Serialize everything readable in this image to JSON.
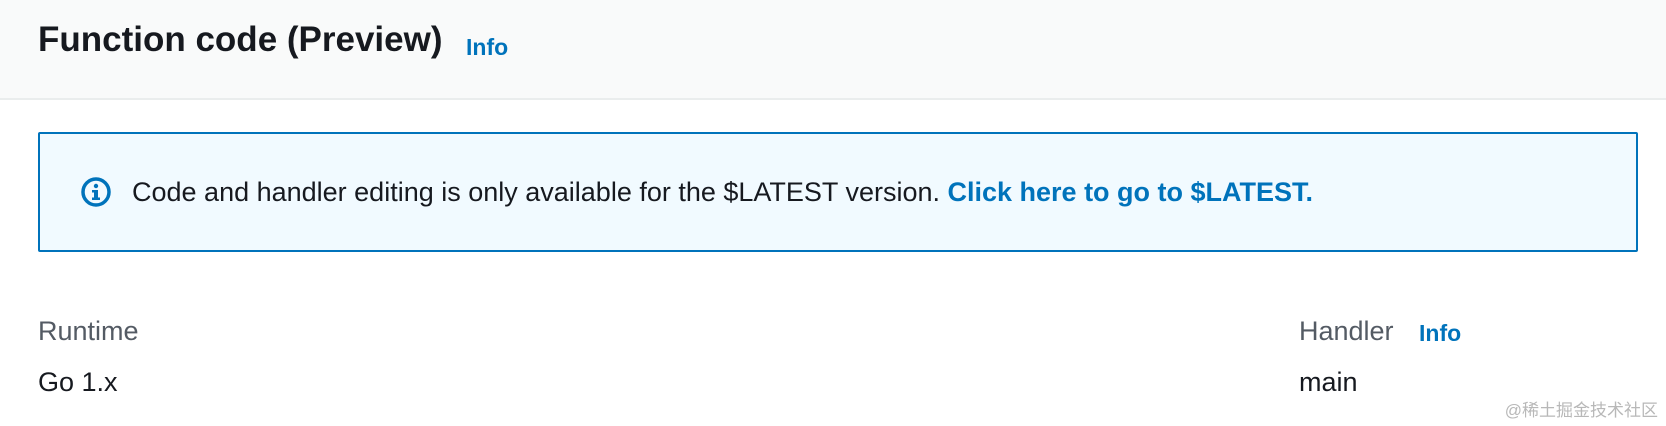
{
  "header": {
    "title": "Function code (Preview)",
    "info_label": "Info"
  },
  "alert": {
    "icon": "info-circle-icon",
    "message": "Code and handler editing is only available for the $LATEST version.",
    "link_label": "Click here to go to $LATEST."
  },
  "runtime": {
    "label": "Runtime",
    "value": "Go 1.x"
  },
  "handler": {
    "label": "Handler",
    "info_label": "Info",
    "value": "main"
  },
  "watermark": "@稀土掘金技术社区",
  "colors": {
    "accent": "#0073bb",
    "alert_bg": "#f1faff",
    "header_bg": "#f9fafa",
    "text": "#16191f",
    "label": "#545b64"
  }
}
